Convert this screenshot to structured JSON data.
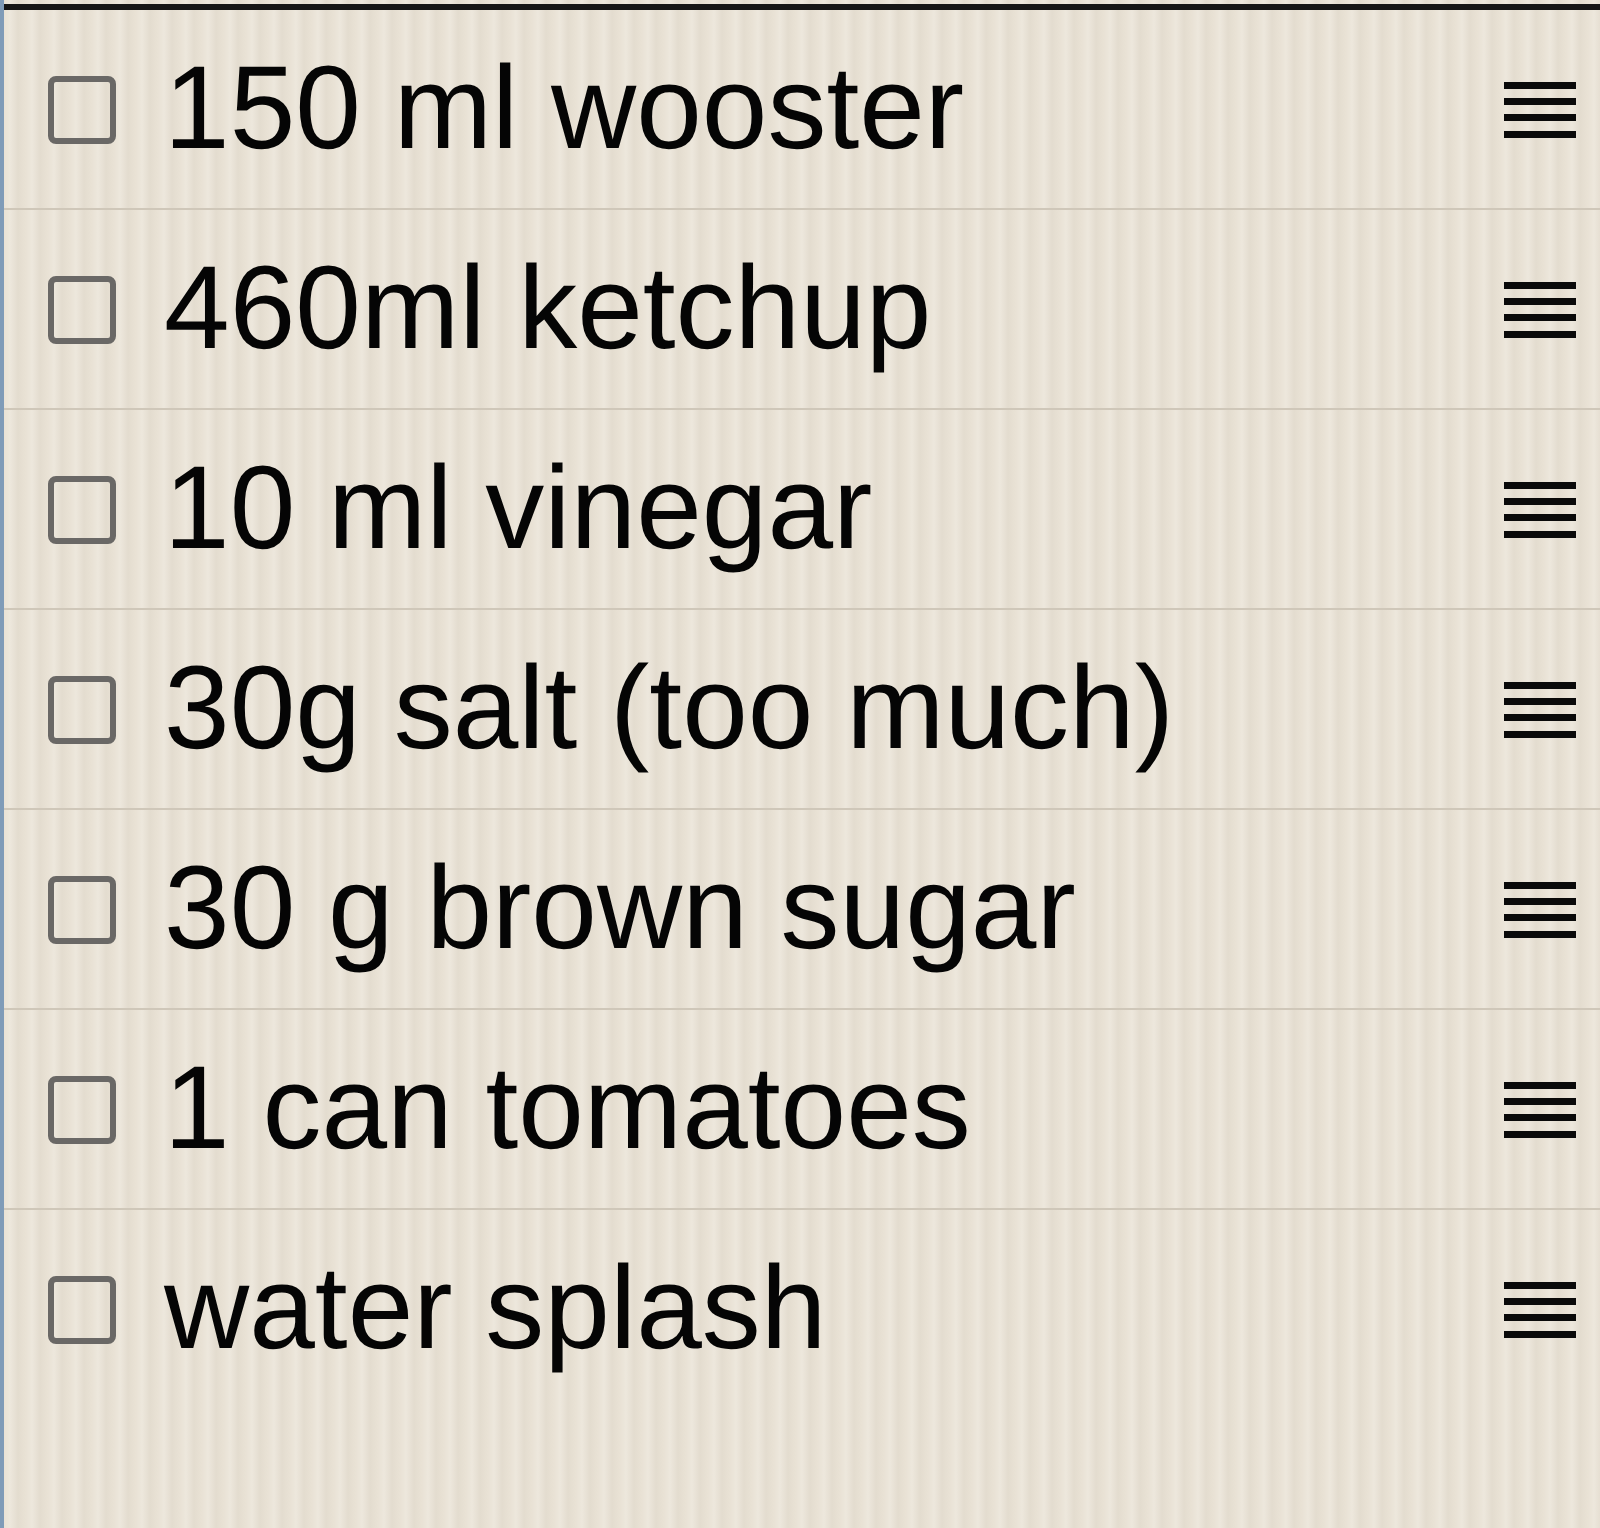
{
  "items": [
    {
      "text": "150 ml wooster",
      "checked": false
    },
    {
      "text": "460ml ketchup",
      "checked": false
    },
    {
      "text": "10 ml vinegar",
      "checked": false
    },
    {
      "text": "30g salt (too much)",
      "checked": false
    },
    {
      "text": "30 g brown sugar",
      "checked": false
    },
    {
      "text": "1 can tomatoes",
      "checked": false
    },
    {
      "text": "water splash",
      "checked": false
    }
  ]
}
